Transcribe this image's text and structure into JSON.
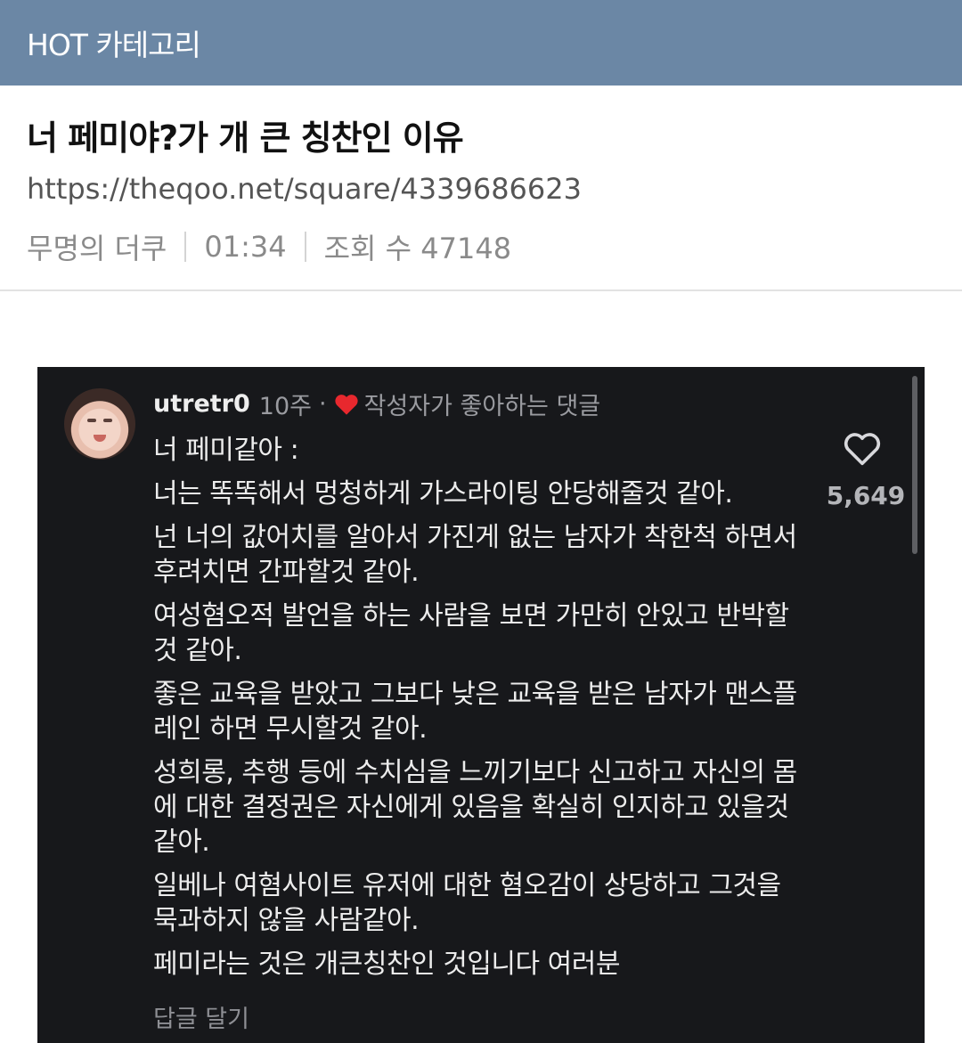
{
  "header": {
    "category": "HOT 카테고리"
  },
  "post": {
    "title": "너 페미야?가 개 큰 칭찬인 이유",
    "url": "https://theqoo.net/square/4339686623",
    "author": "무명의 더쿠",
    "time": "01:34",
    "views": "조회 수 47148"
  },
  "screenshot": {
    "username": "utretr0",
    "age": "10주",
    "separator": "·",
    "creator_liked": "작성자가 좋아하는 댓글",
    "comment_lines": [
      "너 페미같아 :",
      "너는 똑똑해서 멍청하게 가스라이팅 안당해줄것 같아.",
      "넌 너의 값어치를 알아서 가진게 없는 남자가 착한척 하면서 후려치면 간파할것 같아.",
      "여성혐오적 발언을 하는 사람을 보면 가만히 안있고 반박할것 같아.",
      "좋은 교육을 받았고 그보다 낮은 교육을 받은 남자가 맨스플레인 하면 무시할것 같아.",
      "성희롱, 추행 등에 수치심을 느끼기보다 신고하고 자신의 몸에 대한 결정권은 자신에게 있음을 확실히 인지하고 있을것 같아.",
      "일베나 여혐사이트 유저에 대한 혐오감이 상당하고 그것을 묵과하지 않을 사람같아.",
      "페미라는 것은 개큰칭찬인 것입니다 여러분"
    ],
    "reply_label": "답글 달기",
    "like_count": "5,649",
    "icons": {
      "like": "heart-outline-icon",
      "creator_heart": "red-heart-icon"
    },
    "colors": {
      "background": "#17181b",
      "heart": "#e8282e"
    }
  }
}
